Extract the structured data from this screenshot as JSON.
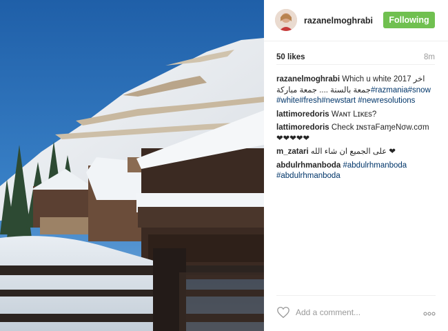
{
  "post": {
    "username": "razanelmoghrabi",
    "follow_label": "Following",
    "likes": "50 likes",
    "time_ago": "8m"
  },
  "comments": [
    {
      "user": "razanelmoghrabi",
      "text": "Which u white 2017 اخر جمعة بالسنة .... جمعة مباركة",
      "tags": [
        "#razmania",
        "#snow",
        "#white",
        "#fresh",
        "#newstart",
        "#newresolutions"
      ]
    },
    {
      "user": "lattimoredoris",
      "text": "Wᴀɴт Lɪĸᴇѕ?"
    },
    {
      "user": "lattimoredoris",
      "text": "Check ɪɴѕтaFaɱeNσw.cσm ❤❤❤❤❤"
    },
    {
      "user": "m_zatari",
      "text": "على الجميع ان شاء الله ❤"
    },
    {
      "user": "abdulrhmanboda",
      "tags": [
        "#abdulrhmanboda",
        "#abdulrhmanboda"
      ]
    }
  ],
  "footer": {
    "comment_placeholder": "Add a comment...",
    "heart_icon": "heart-outline-icon",
    "more_icon": "more-options-icon"
  },
  "colors": {
    "follow_button": "#70c050",
    "hashtag": "#003569",
    "muted_text": "#999999",
    "primary_text": "#262626"
  }
}
